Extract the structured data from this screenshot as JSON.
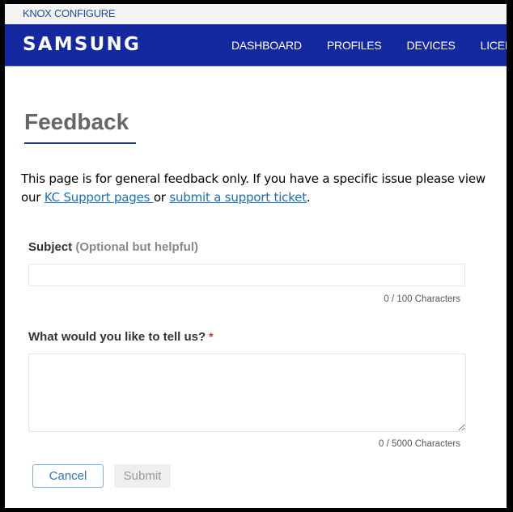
{
  "header": {
    "product_name": "KNOX CONFIGURE",
    "brand_logo": "SAMSUNG",
    "nav_items": [
      {
        "label": "DASHBOARD"
      },
      {
        "label": "PROFILES"
      },
      {
        "label": "DEVICES"
      },
      {
        "label": "LICENSES"
      }
    ]
  },
  "page": {
    "title": "Feedback",
    "intro_text_1": "This page is for general feedback only.  If you have a specific issue please view our ",
    "intro_link_1": "KC Support pages ",
    "intro_text_2": "or ",
    "intro_link_2": "submit a support ticket",
    "intro_text_3": "."
  },
  "form": {
    "subject": {
      "label": "Subject",
      "label_hint": "(Optional but helpful)",
      "value": "",
      "placeholder": "",
      "counter": "0 / 100 Characters"
    },
    "message": {
      "label": "What would you like to tell us?",
      "required_marker": "*",
      "value": "",
      "placeholder": "",
      "counter": "0 / 5000 Characters"
    },
    "cancel_label": "Cancel",
    "submit_label": "Submit"
  },
  "colors": {
    "navbar_bg": "#1428a0",
    "link": "#1a70b5",
    "title_underline": "#1a3c7a",
    "required": "#c0392b"
  }
}
